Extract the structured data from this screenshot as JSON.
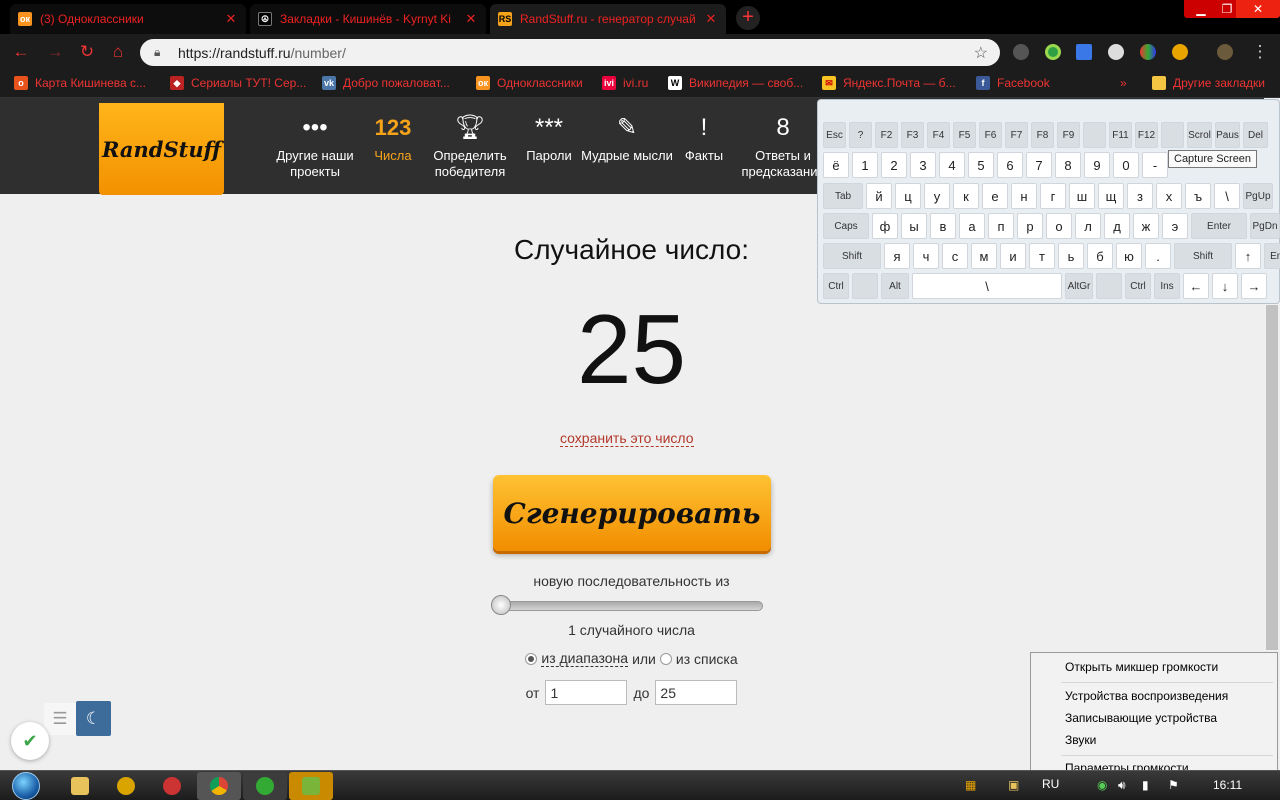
{
  "browser": {
    "tabs": [
      {
        "title": "(3) Одноклассники",
        "favicon": "ok-icon",
        "color": "#f7931e"
      },
      {
        "title": "Закладки - Кишинёв - Kуrnyt Ki",
        "favicon": "bookmark-site-icon",
        "color": "#333333"
      },
      {
        "title": "RandStuff.ru - генератор случай",
        "favicon": "randstuff-icon",
        "color": "#f6a31a"
      }
    ],
    "url_host": "https://randstuff.ru",
    "url_path": "/number/",
    "bookmarks": [
      {
        "label": "Карта Кишинева с...",
        "icon": "map-icon",
        "color": "#e8531d"
      },
      {
        "label": "Сериалы ТУТ! Сер...",
        "icon": "cat-icon",
        "color": "#b22"
      },
      {
        "label": "Добро пожаловат...",
        "icon": "vk-icon",
        "color": "#4a76a8"
      },
      {
        "label": "Одноклассники",
        "icon": "ok-icon",
        "color": "#f7931e"
      },
      {
        "label": "ivi.ru",
        "icon": "ivi-icon",
        "color": "#ea003d"
      },
      {
        "label": "Википедия — своб...",
        "icon": "wikipedia-icon",
        "color": "#ffffff"
      },
      {
        "label": "Яндекс.Почта — б...",
        "icon": "mail-icon",
        "color": "#f7c423"
      },
      {
        "label": "Facebook",
        "icon": "facebook-icon",
        "color": "#3b5998"
      }
    ],
    "other_bookmarks": "Другие закладки",
    "overflow": "»"
  },
  "site": {
    "logo": "RandStuff",
    "nav": [
      {
        "label": "Другие наши проекты",
        "icon": "•••"
      },
      {
        "label": "Числа",
        "icon": "123"
      },
      {
        "label": "Определить победителя",
        "icon": "trophy-icon"
      },
      {
        "label": "Пароли",
        "icon": "***"
      },
      {
        "label": "Мудрые мысли",
        "icon": "scroll-icon"
      },
      {
        "label": "Факты",
        "icon": "!"
      },
      {
        "label": "Ответы и предсказания",
        "icon": "8"
      }
    ],
    "heading": "Случайное число:",
    "number": "25",
    "save_link": "сохранить это число",
    "generate_button": "Сгенерировать",
    "sequence_label": "новую последовательность из",
    "count_label": "1 случайного числа",
    "range_option": "из диапазона",
    "or_text": "или",
    "list_option": "из списка",
    "from_label": "от",
    "from_value": "1",
    "to_label": "до",
    "to_value": "25",
    "slider_fraction": 0,
    "accent": "#f6a31a"
  },
  "keyboard": {
    "row0": [
      "Esc",
      "?",
      "F2",
      "F3",
      "F4",
      "F5",
      "F6",
      "F7",
      "F8",
      "F9",
      "",
      "F11",
      "F12",
      "",
      "Scrol",
      "Paus",
      "Del"
    ],
    "row1": [
      "ё",
      "1",
      "2",
      "3",
      "4",
      "5",
      "6",
      "7",
      "8",
      "9",
      "0",
      "-"
    ],
    "row2": [
      "Tab",
      "й",
      "ц",
      "у",
      "к",
      "е",
      "н",
      "г",
      "ш",
      "щ",
      "з",
      "х",
      "ъ",
      "\\",
      "PgUp"
    ],
    "row3": [
      "Caps",
      "ф",
      "ы",
      "в",
      "а",
      "п",
      "р",
      "о",
      "л",
      "д",
      "ж",
      "э",
      "Enter",
      "PgDn"
    ],
    "row4": [
      "Shift",
      "я",
      "ч",
      "с",
      "м",
      "и",
      "т",
      "ь",
      "б",
      "ю",
      ".",
      "Shift",
      "↑",
      "End"
    ],
    "row5": [
      "Ctrl",
      "",
      "Alt",
      "\\",
      "AltGr",
      "",
      "Ctrl",
      "Ins",
      "←",
      "↓",
      "→"
    ],
    "tooltip": "Capture Screen"
  },
  "context_menu": {
    "items": [
      "Открыть микшер громкости",
      "Устройства воспроизведения",
      "Записывающие устройства",
      "Звуки",
      "Параметры громкости"
    ]
  },
  "taskbar": {
    "language": "RU",
    "time": "16:11"
  }
}
